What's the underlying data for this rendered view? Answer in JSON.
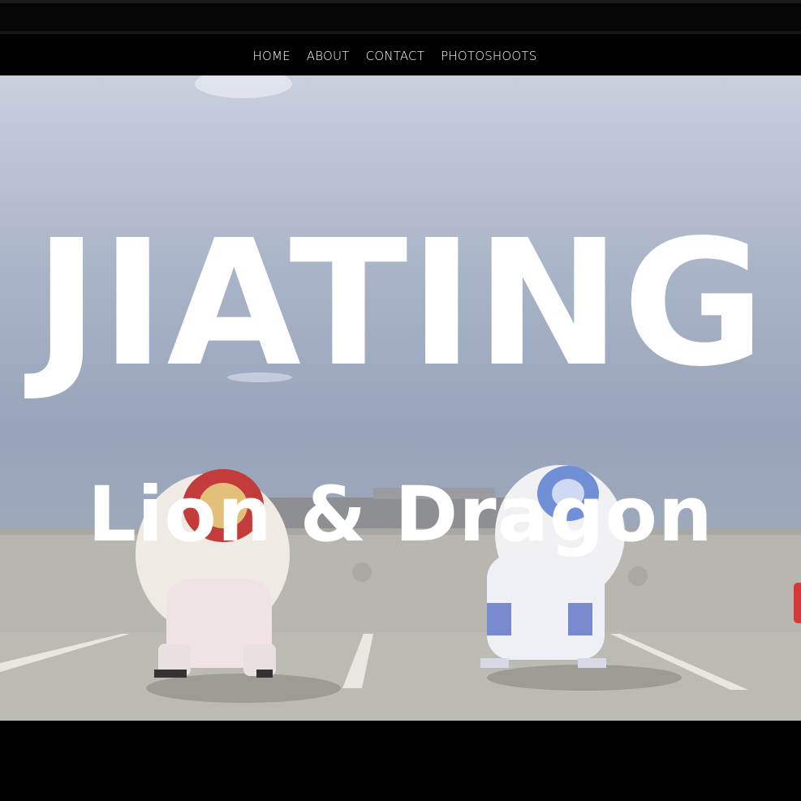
{
  "nav": {
    "items": [
      {
        "label": "HOME"
      },
      {
        "label": "ABOUT"
      },
      {
        "label": "CONTACT"
      },
      {
        "label": "PHOTOSHOOTS"
      }
    ]
  },
  "hero": {
    "title": "JIATING",
    "subtitle": "Lion & Dragon",
    "image_description_icon": "lion-dance-photo"
  },
  "colors": {
    "background": "#000000",
    "text": "#ffffff",
    "sky": "#a4aec3"
  }
}
